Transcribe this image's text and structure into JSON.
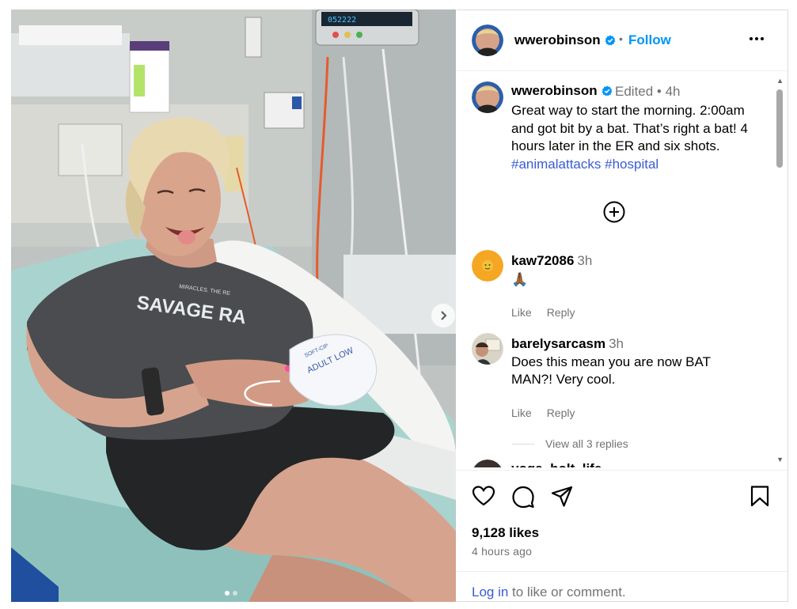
{
  "post": {
    "username": "wwerobinson",
    "follow_label": "Follow",
    "separator": "•",
    "caption": {
      "username": "wwerobinson",
      "meta": "Edited •  4h",
      "text": "Great way to start the morning. 2:00am and got bit by a bat. That’s right a bat! 4 hours later in the ER and six shots.",
      "hashtags": [
        "#animalattacks",
        "#hospital"
      ]
    },
    "comments": [
      {
        "username": "kaw72086",
        "time": "3h",
        "text": "🙏🏾",
        "like": "Like",
        "reply": "Reply"
      },
      {
        "username": "barelysarcasm",
        "time": "3h",
        "text": "Does this mean you are now BAT MAN?! Very cool.",
        "like": "Like",
        "reply": "Reply",
        "view_replies": "View all 3 replies"
      },
      {
        "username": "yoga_holt_life",
        "time": "",
        "text": ""
      }
    ],
    "likes": "9,128 likes",
    "time_ago": "4 hours ago",
    "login_link": "Log in",
    "login_rest": " to like or comment.",
    "photo_text": {
      "shirt": "SAVAGE RA",
      "shirt_small": "MIRACLES. THE RE",
      "wrist_band": "ADULT LOW",
      "label_soft": "SOFT-CIP",
      "monitor": "052222"
    }
  },
  "icons": [
    "verified-badge-icon",
    "more-options-icon",
    "add-comment-icon",
    "heart-icon",
    "comment-icon",
    "share-icon",
    "bookmark-icon",
    "chevron-right-icon"
  ],
  "colors": {
    "link": "#0095f6",
    "hashtag": "#385bd6",
    "muted": "#737373",
    "border": "#dbdbdb"
  }
}
